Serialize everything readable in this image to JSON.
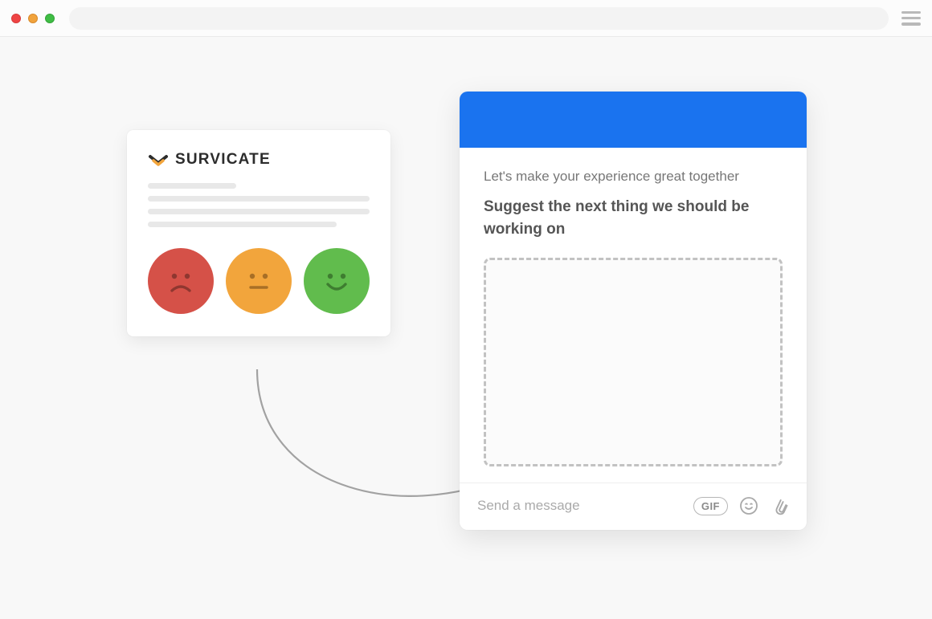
{
  "browser": {
    "address_value": ""
  },
  "survicate": {
    "brand": "SURVICATE",
    "rating_options": [
      {
        "name": "sad",
        "color": "#d55148"
      },
      {
        "name": "neutral",
        "color": "#f2a53c"
      },
      {
        "name": "happy",
        "color": "#61bc4d"
      }
    ]
  },
  "chat": {
    "header_color": "#1a73ef",
    "subtitle": "Let's make your experience great together",
    "title": "Suggest the next thing we should be working on",
    "input_placeholder": "Send a message",
    "actions": {
      "gif_label": "GIF",
      "emoji_icon": "smile-icon",
      "attachment_icon": "paperclip-icon"
    }
  }
}
